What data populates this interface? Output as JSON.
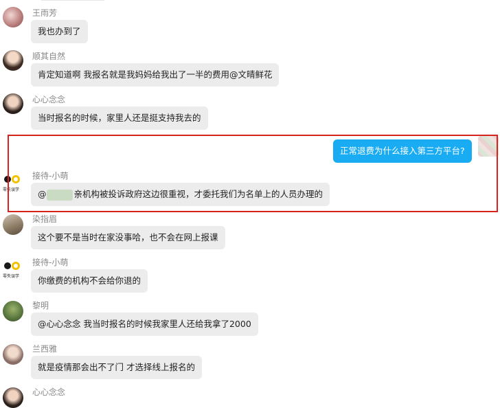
{
  "messages": [
    {
      "name": "王雨芳",
      "text": "我也办到了",
      "avatar": "photo-flowers",
      "color": "#b87b7b"
    },
    {
      "name": "顺其自然",
      "text": "肯定知道啊 我报名就是我妈妈给我出了一半的费用@文晴鲜花",
      "avatar": "photo-woman",
      "color": "#6a5040"
    },
    {
      "name": "心心念念",
      "text": "当时报名的时候，家里人还是挺支持我去的",
      "avatar": "photo-woman-2",
      "color": "#4a3a30"
    },
    {
      "name": "",
      "text": "正常退费为什么接入第三方平台?",
      "avatar": "blurred",
      "color": "#e7c7c4",
      "self": true
    },
    {
      "name": "接待-小萌",
      "text": "亲机构被投诉政府这边很重视，才委托我们为名单上的人员办理的",
      "prefix": "@",
      "avatar": "logo",
      "color": "#f2c200"
    },
    {
      "name": "染指眉",
      "text": "这个要不是当时在家没事哈，也不会在网上报课",
      "avatar": "photo-scene",
      "color": "#9a8c78"
    },
    {
      "name": "接待-小萌",
      "text": "你缴费的机构不会给你退的",
      "avatar": "logo",
      "color": "#f2c200"
    },
    {
      "name": "黎明",
      "text": "@心心念念 我当时报名的时候我家里人还给我拿了2000",
      "avatar": "photo-green",
      "color": "#5c7a40"
    },
    {
      "name": "兰西雅",
      "text": "就是疫情那会出不了门 才选择线上报名的",
      "avatar": "photo-woman-3",
      "color": "#8a6e66"
    },
    {
      "name": "心心念念",
      "text": "",
      "avatar": "photo-woman-2",
      "color": "#4a3a30"
    }
  ],
  "logo_caption": "零失误学"
}
